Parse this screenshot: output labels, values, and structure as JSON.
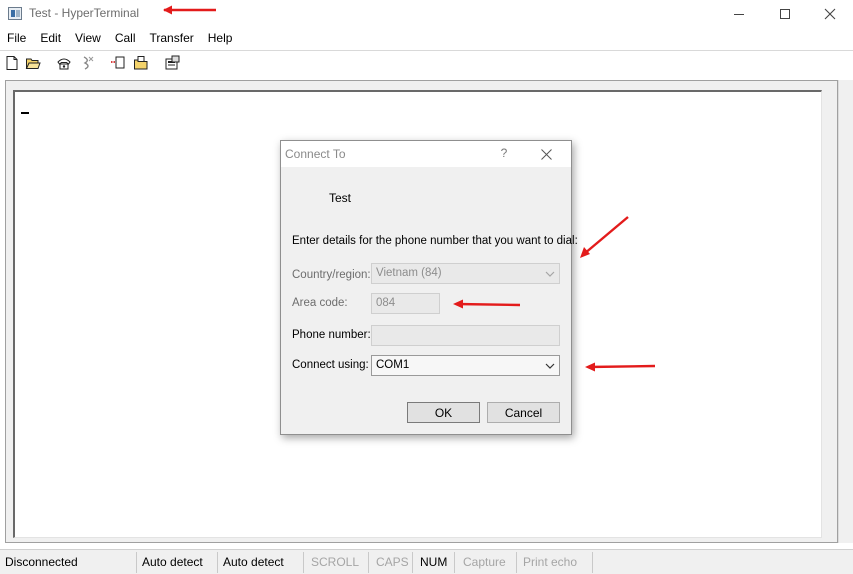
{
  "window": {
    "title": "Test - HyperTerminal"
  },
  "menu": [
    "File",
    "Edit",
    "View",
    "Call",
    "Transfer",
    "Help"
  ],
  "toolbar": {
    "icons": [
      "new-document-icon",
      "open-folder-icon",
      "phone-icon",
      "disconnect-icon",
      "send-icon",
      "receive-icon",
      "properties-icon"
    ]
  },
  "dialog": {
    "title": "Connect To",
    "help": "?",
    "connection_name": "Test",
    "instruction": "Enter details for the phone number that you want to dial:",
    "country_label": "Country/region:",
    "country_value": "Vietnam (84)",
    "area_label": "Area code:",
    "area_value": "084",
    "phone_label": "Phone number:",
    "phone_value": "",
    "connect_label": "Connect using:",
    "connect_value": "COM1",
    "ok_label": "OK",
    "cancel_label": "Cancel"
  },
  "statusbar": {
    "cells": [
      "Disconnected",
      "Auto detect",
      "Auto detect",
      "SCROLL",
      "CAPS",
      "NUM",
      "Capture",
      "Print echo"
    ]
  },
  "colors": {
    "annotation_arrow": "#e31b1b",
    "disabled_text": "#8d8d8d"
  }
}
